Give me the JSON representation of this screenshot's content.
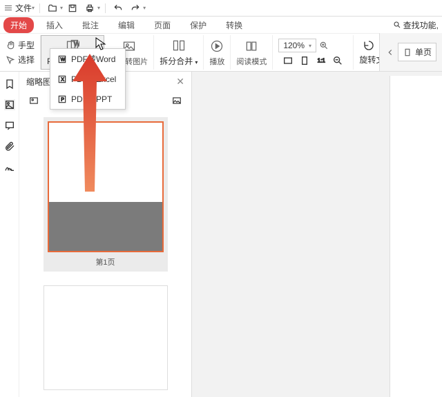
{
  "topbar": {
    "file_label": "文件"
  },
  "tabs": {
    "start": "开始",
    "insert": "插入",
    "annotate": "批注",
    "edit": "编辑",
    "page": "页面",
    "protect": "保护",
    "convert": "转换",
    "search_placeholder": "查找功能,"
  },
  "ribbon": {
    "hand": "手型",
    "select": "选择",
    "pdf_office": "PDF转Office",
    "pdf_image": "PDF转图片",
    "split_merge": "拆分合并",
    "play": "播放",
    "read_mode": "阅读模式",
    "zoom_value": "120%",
    "rotate_doc": "旋转文档",
    "single_page": "单页"
  },
  "dropdown": {
    "word": "PDF转Word",
    "excel": "PDF转Excel",
    "ppt": "PDF转PPT"
  },
  "thumbs": {
    "title": "缩略图",
    "page1_caption": "第1页"
  }
}
